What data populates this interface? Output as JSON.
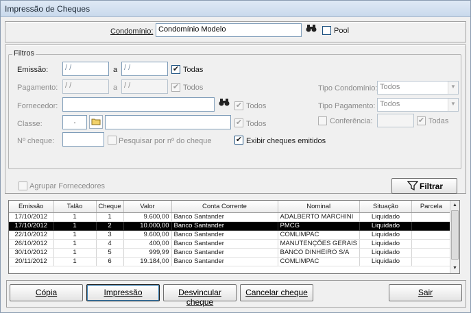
{
  "window": {
    "title": "Impressão de Cheques"
  },
  "header": {
    "condominio_label": "Condomínio:",
    "condominio_value": "Condomínio Modelo",
    "binoculars_icon": "binoculars-icon",
    "pool_label": "Pool",
    "pool_checked": ""
  },
  "filtros": {
    "legend": "Filtros",
    "emissao_label": "Emissão:",
    "emissao_from": "/ /",
    "a_label": "a",
    "emissao_to": "/ /",
    "emissao_todas_label": "Todas",
    "emissao_todas_check": "✔",
    "pagamento_label": "Pagamento:",
    "pagamento_from": "/ /",
    "pagamento_to": "/ /",
    "pagamento_todos_label": "Todos",
    "pagamento_todos_check": "✔",
    "fornecedor_label": "Fornecedor:",
    "fornecedor_value": "",
    "fornecedor_todos_label": "Todos",
    "fornecedor_todos_check": "✔",
    "classe_label": "Classe:",
    "classe_code": ".",
    "classe_value": "",
    "classe_todos_label": "Todos",
    "classe_todos_check": "✔",
    "ncheque_label": "Nº cheque:",
    "ncheque_value": "",
    "pesquisar_label": "Pesquisar por nº do cheque",
    "exibir_label": "Exibir cheques emitidos",
    "exibir_check": "✔",
    "tipo_condominio_label": "Tipo Condomínio:",
    "tipo_condominio_value": "Todos",
    "tipo_pagamento_label": "Tipo Pagamento:",
    "tipo_pagamento_value": "Todos",
    "conferencia_label": "Conferência:",
    "conferencia_value": "",
    "conferencia_todas_label": "Todas",
    "conferencia_todas_check": "✔"
  },
  "agrupar_label": "Agrupar Fornecedores",
  "filtrar_label": "Filtrar",
  "table": {
    "columns": [
      "Emissão",
      "Talão",
      "Cheque",
      "Valor",
      "Conta Corrente",
      "Nominal",
      "Situação",
      "Parcela"
    ],
    "rows": [
      [
        "17/10/2012",
        "1",
        "1",
        "9.600,00",
        "Banco Santander",
        "ADALBERTO MARCHINI",
        "Liquidado",
        ""
      ],
      [
        "17/10/2012",
        "1",
        "2",
        "10.000,00",
        "Banco Santander",
        "PMCG",
        "Liquidado",
        ""
      ],
      [
        "22/10/2012",
        "1",
        "3",
        "9.600,00",
        "Banco Santander",
        "COMLIMPAC",
        "Liquidado",
        ""
      ],
      [
        "26/10/2012",
        "1",
        "4",
        "400,00",
        "Banco Santander",
        "MANUTENÇÕES GERAIS",
        "Liquidado",
        ""
      ],
      [
        "30/10/2012",
        "1",
        "5",
        "999,99",
        "Banco Santander",
        "BANCO DINHEIRO S/A",
        "Liquidado",
        ""
      ],
      [
        "20/11/2012",
        "1",
        "6",
        "19.184,00",
        "Banco Santander",
        "COMLIMPAC",
        "Liquidado",
        ""
      ]
    ],
    "selected_row": 1
  },
  "footer": {
    "copia": "Cópia",
    "impressao": "Impressão",
    "desvincular": "Desvincular cheque",
    "cancelar": "Cancelar cheque",
    "sair": "Sair"
  },
  "colors": {
    "selected_row_bg": "#000000",
    "titlebar": "#c9d9ec"
  }
}
